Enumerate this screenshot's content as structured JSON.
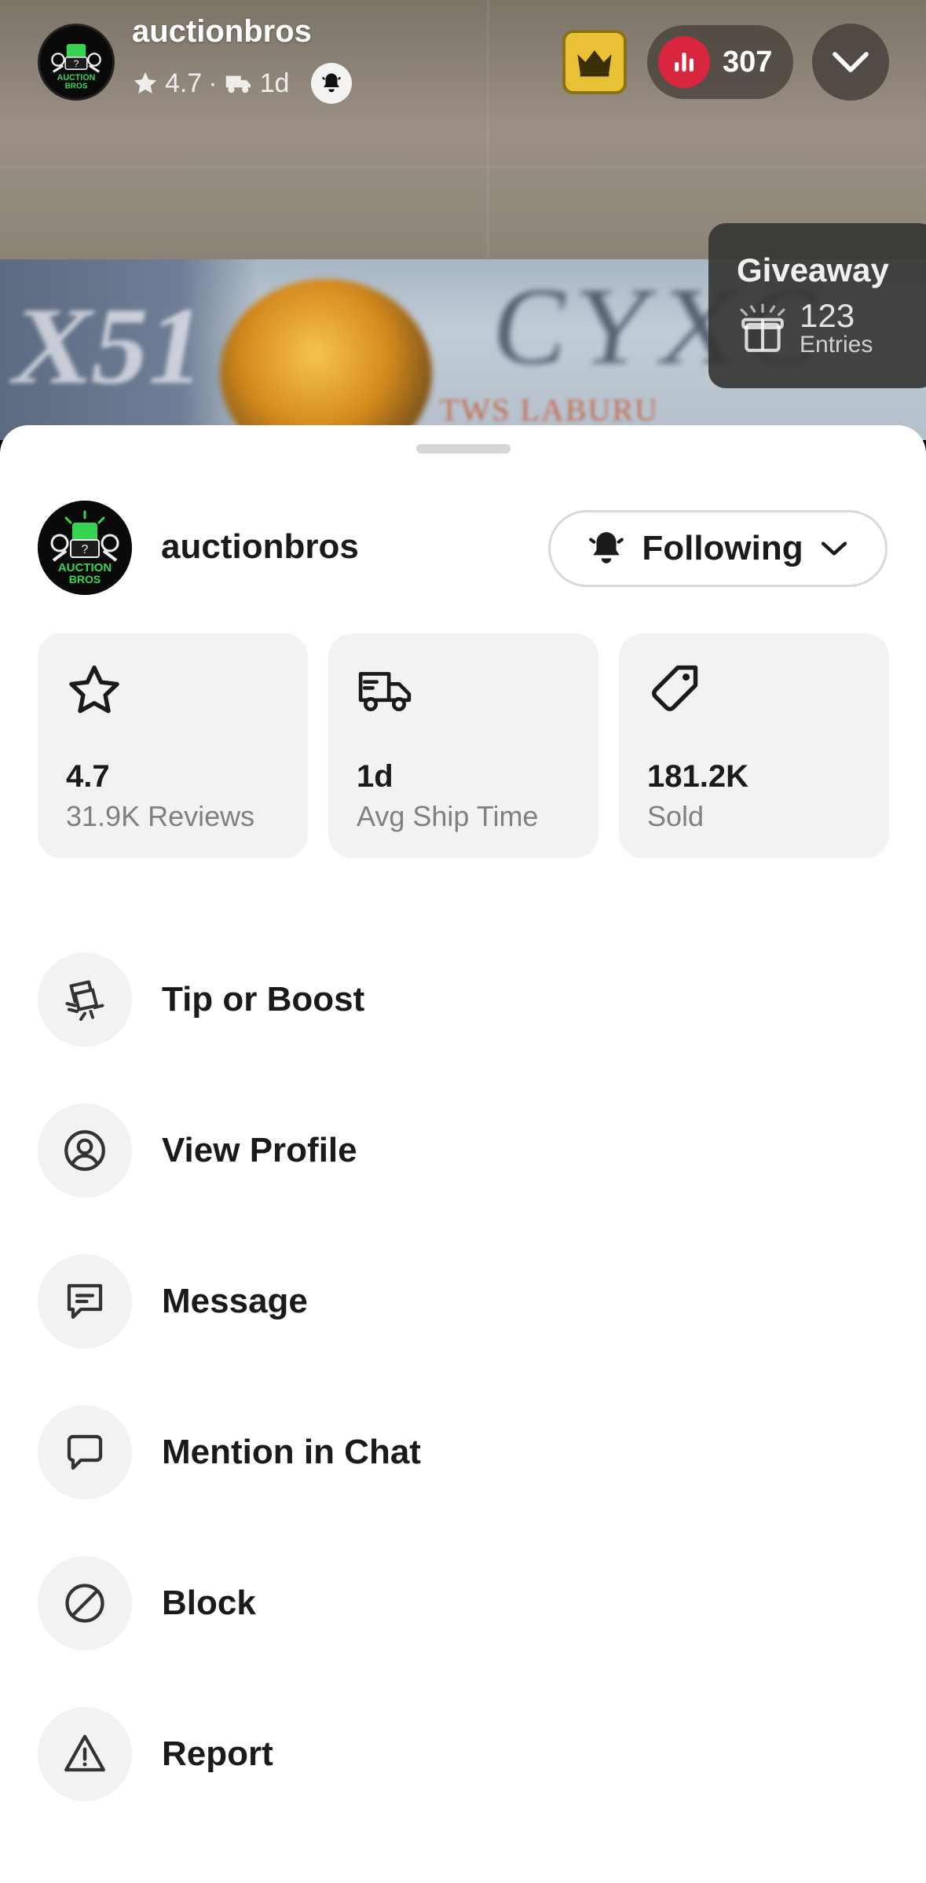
{
  "stream": {
    "host_name": "auctionbros",
    "host_rating": "4.7",
    "host_ship_time": "1d",
    "viewer_count": "307",
    "giveaway": {
      "title": "Giveaway",
      "entries_count": "123",
      "entries_label": "Entries"
    },
    "background_text": {
      "left": "X51",
      "right": "CYXC",
      "bottom": "TWS LABURU"
    }
  },
  "avatar": {
    "brand_line1": "AUCTION",
    "brand_line2": "BROS",
    "mark": "?"
  },
  "sheet": {
    "seller_name": "auctionbros",
    "follow_label": "Following",
    "stats": [
      {
        "icon": "star-icon",
        "value": "4.7",
        "label": "31.9K Reviews"
      },
      {
        "icon": "truck-icon",
        "value": "1d",
        "label": "Avg Ship Time"
      },
      {
        "icon": "tag-icon",
        "value": "181.2K",
        "label": "Sold"
      }
    ],
    "actions": [
      {
        "icon": "tip-boost-icon",
        "label": "Tip or Boost"
      },
      {
        "icon": "profile-icon",
        "label": "View Profile"
      },
      {
        "icon": "message-icon",
        "label": "Message"
      },
      {
        "icon": "chat-bubble-icon",
        "label": "Mention in Chat"
      },
      {
        "icon": "block-icon",
        "label": "Block"
      },
      {
        "icon": "warning-icon",
        "label": "Report"
      }
    ]
  },
  "colors": {
    "accent_live": "#d7263d",
    "crown_gold": "#e8c234",
    "avatar_green": "#39d353",
    "sheet_card_bg": "#f2f2f2",
    "text_primary": "#1a1a1a",
    "text_secondary": "#808080"
  }
}
